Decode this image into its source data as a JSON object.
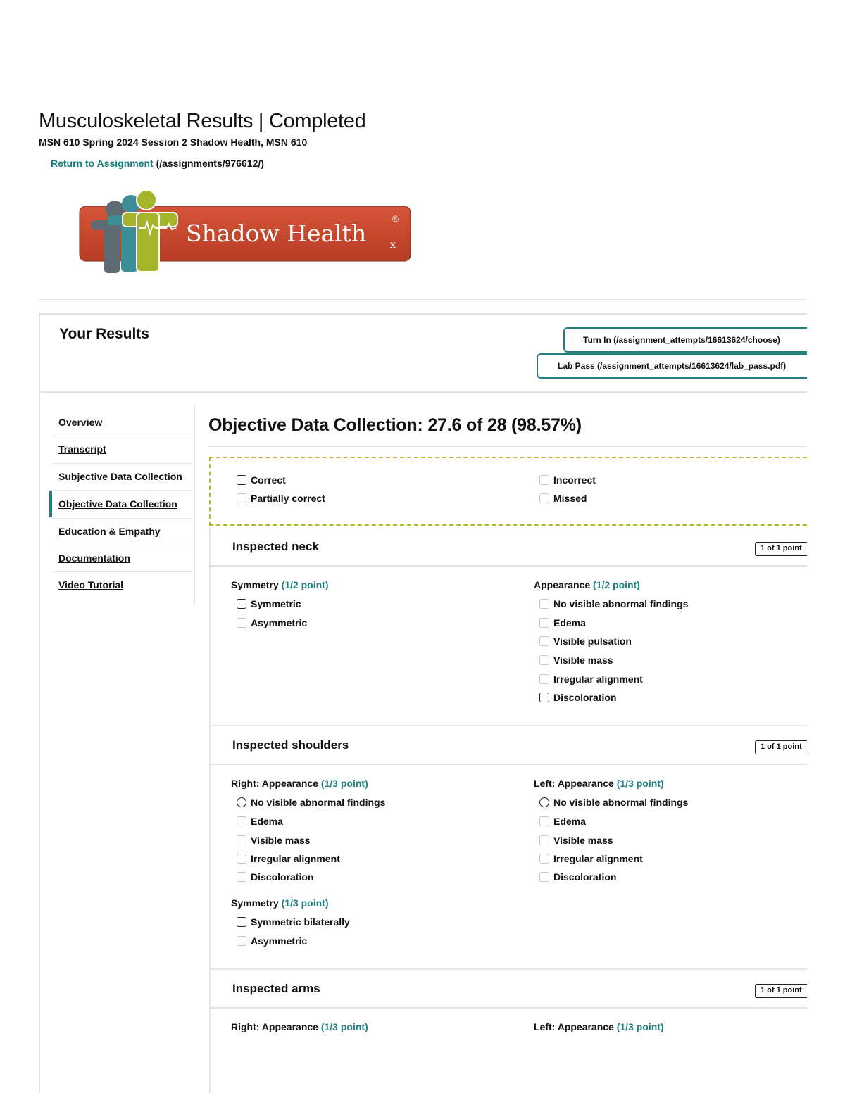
{
  "header": {
    "title": "Musculoskeletal Results | Completed",
    "subtitle": "MSN 610 Spring 2024 Session 2 Shadow Health, MSN 610",
    "return_label": "Return to Assignment",
    "return_path": "(/assignments/976612/)"
  },
  "logo": {
    "text": "Shadow Health",
    "registered": "®",
    "rx": "x"
  },
  "results": {
    "title": "Your Results",
    "turn_in_label": "Turn In (/assignment_attempts/16613624/choose)",
    "lab_pass_label": "Lab Pass (/assignment_attempts/16613624/lab_pass.pdf)"
  },
  "sidebar": {
    "items": [
      {
        "label": "Overview"
      },
      {
        "label": "Transcript"
      },
      {
        "label": "Subjective Data Collection"
      },
      {
        "label": "Objective Data Collection"
      },
      {
        "label": "Education & Empathy"
      },
      {
        "label": "Documentation"
      },
      {
        "label": "Video Tutorial"
      }
    ],
    "active_index": 3
  },
  "main": {
    "heading": "Objective Data Collection: 27.6 of 28 (98.57%)",
    "legend": {
      "correct": "Correct",
      "partially_correct": "Partially correct",
      "incorrect": "Incorrect",
      "missed": "Missed"
    },
    "sections": [
      {
        "title": "Inspected neck",
        "badge": "1 of 1 point",
        "questions": [
          {
            "title": "Symmetry",
            "points": "(1/2 point)",
            "options": [
              "Symmetric",
              "Asymmetric"
            ]
          },
          {
            "title": "Appearance",
            "points": "(1/2 point)",
            "options": [
              "No visible abnormal findings",
              "Edema",
              "Visible pulsation",
              "Visible mass",
              "Irregular alignment",
              "Discoloration"
            ]
          }
        ]
      },
      {
        "title": "Inspected shoulders",
        "badge": "1 of 1 point",
        "questions": [
          {
            "title": "Right: Appearance",
            "points": "(1/3 point)",
            "options": [
              "No visible abnormal findings",
              "Edema",
              "Visible mass",
              "Irregular alignment",
              "Discoloration"
            ]
          },
          {
            "title": "Left: Appearance",
            "points": "(1/3 point)",
            "options": [
              "No visible abnormal findings",
              "Edema",
              "Visible mass",
              "Irregular alignment",
              "Discoloration"
            ]
          },
          {
            "title": "Symmetry",
            "points": "(1/3 point)",
            "options": [
              "Symmetric bilaterally",
              "Asymmetric"
            ]
          }
        ]
      },
      {
        "title": "Inspected arms",
        "badge": "1 of 1 point",
        "questions": [
          {
            "title": "Right: Appearance",
            "points": "(1/3 point)"
          },
          {
            "title": "Left: Appearance",
            "points": "(1/3 point)"
          }
        ]
      }
    ]
  },
  "colors": {
    "accent": "#1f7f80",
    "logo_orange": "#c9482a",
    "logo_green": "#a4b52a",
    "legend_border": "#b6b62a"
  }
}
